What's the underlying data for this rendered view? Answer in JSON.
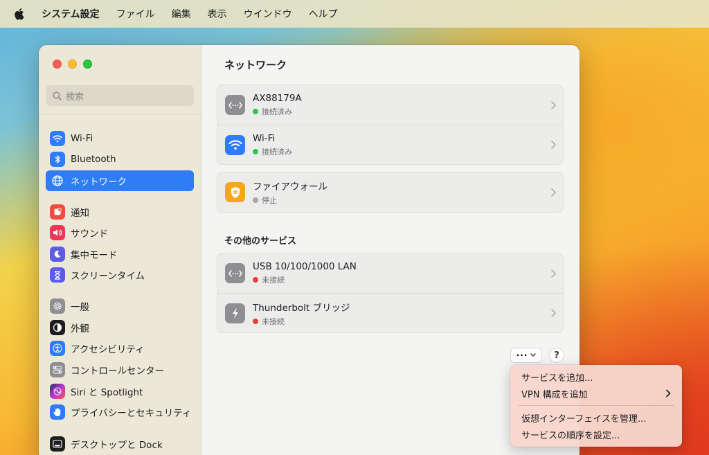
{
  "menubar": {
    "app_name": "システム設定",
    "items": [
      "ファイル",
      "編集",
      "表示",
      "ウインドウ",
      "ヘルプ"
    ]
  },
  "sidebar": {
    "search_placeholder": "検索",
    "items": [
      {
        "label": "Wi-Fi",
        "icon": "wifi-icon",
        "color": "#2f7df6"
      },
      {
        "label": "Bluetooth",
        "icon": "bluetooth-icon",
        "color": "#2f7df6"
      },
      {
        "label": "ネットワーク",
        "icon": "globe-icon",
        "color": "#2f7df6",
        "active": true
      },
      {
        "label": "通知",
        "icon": "bell-icon",
        "color": "#f24a3d"
      },
      {
        "label": "サウンド",
        "icon": "speaker-icon",
        "color": "#f2365a"
      },
      {
        "label": "集中モード",
        "icon": "moon-icon",
        "color": "#5e5ce6"
      },
      {
        "label": "スクリーンタイム",
        "icon": "hourglass-icon",
        "color": "#5e5ce6"
      },
      {
        "label": "一般",
        "icon": "gear-icon",
        "color": "#8e8e93"
      },
      {
        "label": "外観",
        "icon": "appearance-icon",
        "color": "#1d1d1f"
      },
      {
        "label": "アクセシビリティ",
        "icon": "accessibility-icon",
        "color": "#2f7df6"
      },
      {
        "label": "コントロールセンター",
        "icon": "toggles-icon",
        "color": "#8e8e93"
      },
      {
        "label": "Siri と Spotlight",
        "icon": "siri-icon",
        "color": "#6a3fd4"
      },
      {
        "label": "プライバシーとセキュリティ",
        "icon": "hand-icon",
        "color": "#2f7df6"
      },
      {
        "label": "デスクトップと Dock",
        "icon": "dock-icon",
        "color": "#1d1d1f"
      }
    ]
  },
  "main": {
    "title": "ネットワーク",
    "connections": [
      {
        "name": "AX88179A",
        "status": "接続済み",
        "status_color": "#30c54f",
        "icon": "ethernet-icon"
      },
      {
        "name": "Wi-Fi",
        "status": "接続済み",
        "status_color": "#30c54f",
        "icon": "wifi-icon"
      }
    ],
    "firewall": {
      "name": "ファイアウォール",
      "status": "停止",
      "status_color": "#a5a5a5",
      "icon": "firewall-icon"
    },
    "other_services_title": "その他のサービス",
    "other_services": [
      {
        "name": "USB 10/100/1000 LAN",
        "status": "未接続",
        "status_color": "#e5403a",
        "icon": "ethernet-icon"
      },
      {
        "name": "Thunderbolt ブリッジ",
        "status": "未接続",
        "status_color": "#e5403a",
        "icon": "thunderbolt-icon"
      }
    ],
    "more_button": "···",
    "help_button": "?"
  },
  "context_menu": {
    "items": [
      {
        "label": "サービスを追加..."
      },
      {
        "label": "VPN 構成を追加",
        "has_submenu": true
      },
      {
        "label": "仮想インターフェイスを管理..."
      },
      {
        "label": "サービスの順序を設定..."
      }
    ]
  }
}
